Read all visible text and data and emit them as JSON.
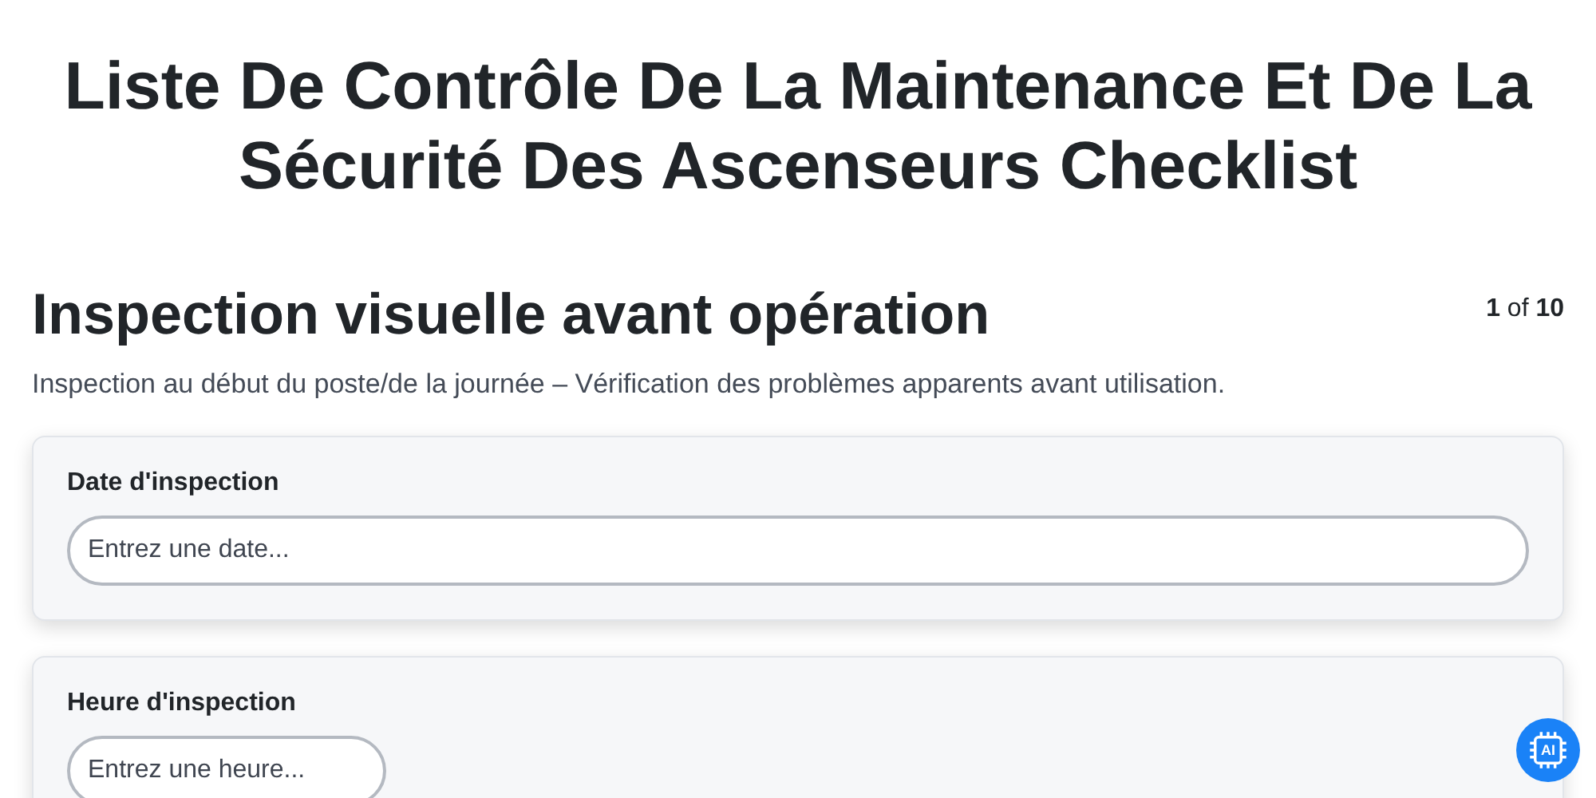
{
  "title": "Liste De Contrôle De La Maintenance Et De La Sécurité Des Ascenseurs Checklist",
  "section": {
    "heading": "Inspection visuelle avant opération",
    "counter": "**1** of **10**",
    "description": "Inspection au début du poste/de la journée – Vérification des problèmes apparents avant utilisation."
  },
  "fields": [
    {
      "label": "Date d'inspection",
      "placeholder": "Entrez une date...",
      "kind": "date"
    },
    {
      "label": "Heure d'inspection",
      "placeholder": "Entrez une heure...",
      "kind": "time"
    }
  ],
  "ai_badge": {
    "label": "AI"
  }
}
